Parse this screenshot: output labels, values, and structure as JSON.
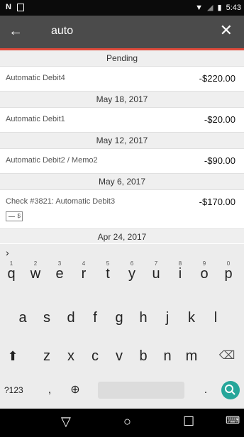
{
  "status": {
    "time": "5:43"
  },
  "toolbar": {
    "query": "auto"
  },
  "list": {
    "headers": [
      "Pending",
      "May 18, 2017",
      "May 12, 2017",
      "May 6, 2017",
      "Apr 24, 2017"
    ],
    "rows": [
      {
        "desc": "Automatic Debit4",
        "amount": "-$220.00"
      },
      {
        "desc": "Automatic Debit1",
        "amount": "-$20.00"
      },
      {
        "desc": "Automatic Debit2 / Memo2",
        "amount": "-$90.00"
      },
      {
        "desc": "Check #3821: Automatic Debit3",
        "amount": "-$170.00"
      }
    ]
  },
  "keyboard": {
    "row1": [
      "q",
      "w",
      "e",
      "r",
      "t",
      "y",
      "u",
      "i",
      "o",
      "p"
    ],
    "row1_numbers": [
      "1",
      "2",
      "3",
      "4",
      "5",
      "6",
      "7",
      "8",
      "9",
      "0"
    ],
    "row2": [
      "a",
      "s",
      "d",
      "f",
      "g",
      "h",
      "j",
      "k",
      "l"
    ],
    "row3": [
      "z",
      "x",
      "c",
      "v",
      "b",
      "n",
      "m"
    ],
    "symbols_label": "?123",
    "comma": ",",
    "period": "."
  },
  "icons": {
    "back": "back-arrow-icon",
    "close": "close-icon",
    "shift": "shift-icon",
    "backspace": "backspace-icon",
    "globe": "globe-icon",
    "search": "search-icon",
    "nav_back": "nav-back-icon",
    "nav_home": "nav-home-icon",
    "nav_recent": "nav-recent-icon",
    "keyboard_switch": "keyboard-icon"
  }
}
